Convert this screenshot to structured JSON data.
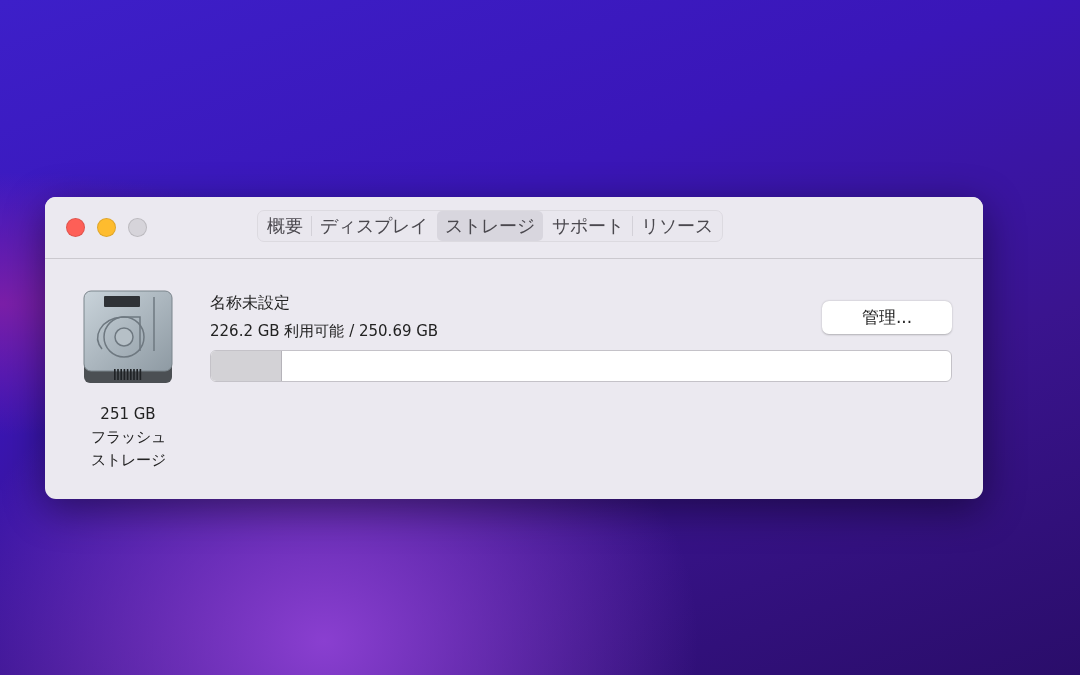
{
  "window": {
    "tabs": [
      {
        "label": "概要",
        "selected": false
      },
      {
        "label": "ディスプレイ",
        "selected": false
      },
      {
        "label": "ストレージ",
        "selected": true
      },
      {
        "label": "サポート",
        "selected": false
      },
      {
        "label": "リソース",
        "selected": false
      }
    ]
  },
  "drive": {
    "capacity": "251 GB",
    "type_lines": [
      "フラッシュ",
      "ストレージ"
    ]
  },
  "volume": {
    "name": "名称未設定",
    "usage": "226.2 GB 利用可能 / 250.69 GB",
    "level": 0.096
  },
  "buttons": [
    {
      "label": "管理..."
    }
  ]
}
